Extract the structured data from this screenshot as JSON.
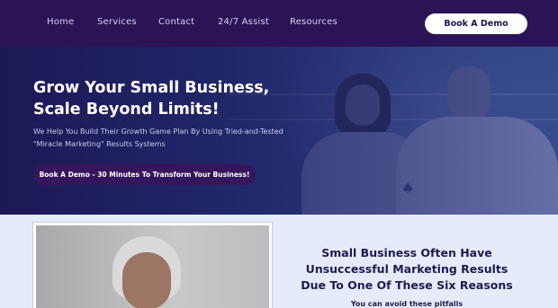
{
  "nav": {
    "items": [
      "Home",
      "Services",
      "Contact",
      "24/7 Assist",
      "Resources"
    ],
    "cta_label": "Book A Demo"
  },
  "hero": {
    "title_line1": "Grow Your Small Business,",
    "title_line2": "Scale Beyond Limits!",
    "desc_line1": "We Help You Build Their Growth Game Plan By Using Tried-and-Tested",
    "desc_line2": "\"Miracle Marketing\" Results Systems",
    "button_label": "Book A Demo - 30 Minutes To Transform Your Business!"
  },
  "section": {
    "heading_line1": "Small Business Often Have",
    "heading_line2": "Unsuccessful Marketing Results",
    "heading_line3": "Due To One Of These Six Reasons",
    "subheading": "You can avoid these pitfalls"
  },
  "colors": {
    "nav_bg": "#2a1456",
    "hero_button_bg": "#35155c",
    "heading_text": "#1c1c4e"
  }
}
